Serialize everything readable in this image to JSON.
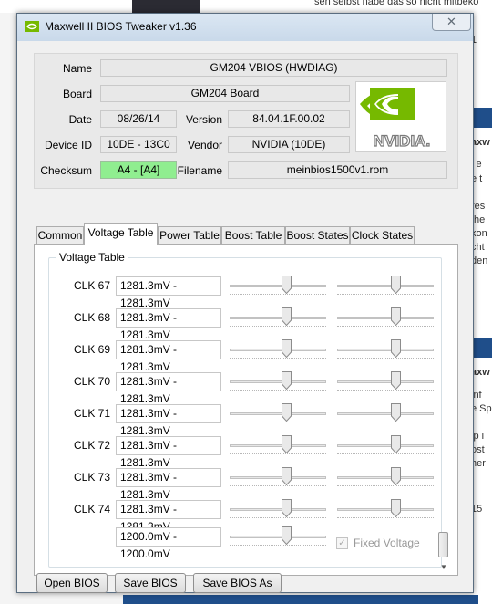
{
  "background": {
    "top_text": "sen selbst habe das so nicht mitbeko",
    "fragments": [
      "1",
      "axw",
      "l e",
      "e t",
      "res",
      "the",
      "kon",
      "cht",
      "den",
      "axw",
      "inf",
      "e Sp",
      "ip i",
      "ost",
      "her",
      "15"
    ]
  },
  "window": {
    "title": "Maxwell II BIOS Tweaker v1.36",
    "close_symbol": "✕"
  },
  "info": {
    "name_label": "Name",
    "name_value": "GM204 VBIOS (HWDIAG)",
    "board_label": "Board",
    "board_value": "GM204 Board",
    "date_label": "Date",
    "date_value": "08/26/14",
    "version_label": "Version",
    "version_value": "84.04.1F.00.02",
    "device_id_label": "Device ID",
    "device_id_value": "10DE - 13C0",
    "vendor_label": "Vendor",
    "vendor_value": "NVIDIA (10DE)",
    "checksum_label": "Checksum",
    "checksum_value": "A4 - [A4]",
    "filename_label": "Filename",
    "filename_value": "meinbios1500v1.rom",
    "logo_text": "NVIDIA.",
    "logo_icon": "nvidia-eye-logo",
    "logo_color": "#76b900",
    "checksum_color": "#90ee90"
  },
  "tabs": [
    {
      "label": "Common",
      "active": false
    },
    {
      "label": "Voltage Table",
      "active": true
    },
    {
      "label": "Power Table",
      "active": false
    },
    {
      "label": "Boost Table",
      "active": false
    },
    {
      "label": "Boost States",
      "active": false
    },
    {
      "label": "Clock States",
      "active": false
    }
  ],
  "voltage_table": {
    "title": "Voltage Table",
    "rows": [
      {
        "clk": "CLK 67",
        "voltage": "1281.3mV - 1281.3mV"
      },
      {
        "clk": "CLK 68",
        "voltage": "1281.3mV - 1281.3mV"
      },
      {
        "clk": "CLK 69",
        "voltage": "1281.3mV - 1281.3mV"
      },
      {
        "clk": "CLK 70",
        "voltage": "1281.3mV - 1281.3mV"
      },
      {
        "clk": "CLK 71",
        "voltage": "1281.3mV - 1281.3mV"
      },
      {
        "clk": "CLK 72",
        "voltage": "1281.3mV - 1281.3mV"
      },
      {
        "clk": "CLK 73",
        "voltage": "1281.3mV - 1281.3mV"
      },
      {
        "clk": "CLK 74",
        "voltage": "1281.3mV - 1281.3mV"
      }
    ],
    "fixed_voltage_value": "1200.0mV - 1200.0mV",
    "fixed_voltage_label": "Fixed Voltage",
    "fixed_voltage_checked": true
  },
  "buttons": {
    "open": "Open BIOS",
    "save": "Save BIOS",
    "save_as": "Save BIOS As"
  }
}
